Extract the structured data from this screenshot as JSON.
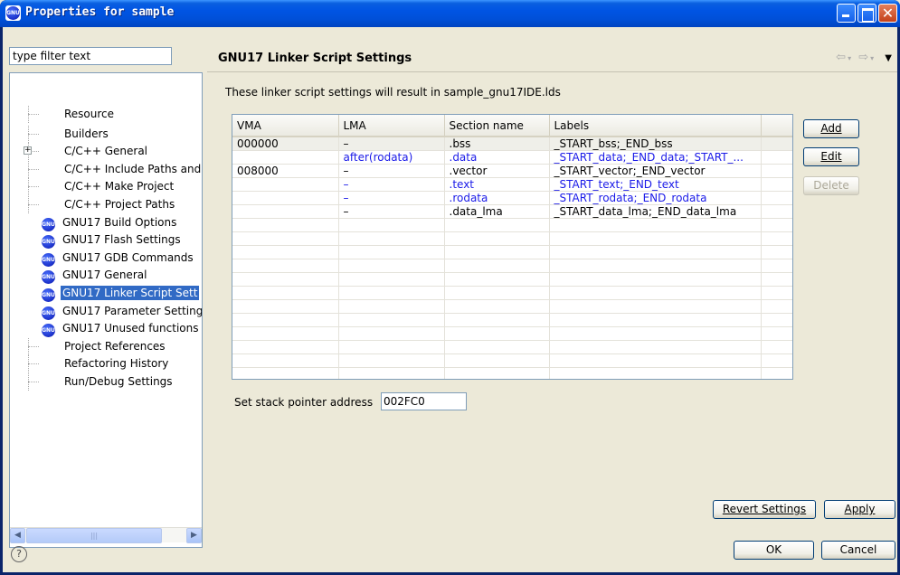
{
  "window": {
    "title": "Properties for sample"
  },
  "filter": {
    "value": "type filter text"
  },
  "tree": {
    "items": [
      {
        "label": "Resource",
        "kind": "plain"
      },
      {
        "label": "Builders",
        "kind": "plain"
      },
      {
        "label": "C/C++ General",
        "kind": "expandable"
      },
      {
        "label": "C/C++ Include Paths and",
        "kind": "plain"
      },
      {
        "label": "C/C++ Make Project",
        "kind": "plain"
      },
      {
        "label": "C/C++ Project Paths",
        "kind": "plain"
      },
      {
        "label": "GNU17 Build Options",
        "kind": "gnu"
      },
      {
        "label": "GNU17 Flash Settings",
        "kind": "gnu"
      },
      {
        "label": "GNU17 GDB Commands",
        "kind": "gnu"
      },
      {
        "label": "GNU17 General",
        "kind": "gnu"
      },
      {
        "label": "GNU17 Linker Script Sett",
        "kind": "gnu",
        "selected": true
      },
      {
        "label": "GNU17 Parameter Setting",
        "kind": "gnu"
      },
      {
        "label": "GNU17 Unused functions",
        "kind": "gnu"
      },
      {
        "label": "Project References",
        "kind": "plain"
      },
      {
        "label": "Refactoring History",
        "kind": "plain"
      },
      {
        "label": "Run/Debug Settings",
        "kind": "plain"
      }
    ],
    "expander_symbol": "+",
    "gnu_icon_text": "GNU"
  },
  "panel": {
    "title": "GNU17 Linker Script Settings",
    "description": "These linker script settings will result in sample_gnu17IDE.lds"
  },
  "table": {
    "columns": [
      "VMA",
      "LMA",
      "Section name",
      "Labels"
    ],
    "rows": [
      {
        "vma": "000000",
        "lma": "–",
        "section": ".bss",
        "labels": "_START_bss;_END_bss",
        "color": "black"
      },
      {
        "vma": "",
        "lma": "after(rodata)",
        "section": ".data",
        "labels": "_START_data;_END_data;_START_...",
        "color": "blue"
      },
      {
        "vma": "008000",
        "lma": "–",
        "section": ".vector",
        "labels": "_START_vector;_END_vector",
        "color": "black"
      },
      {
        "vma": "",
        "lma": "–",
        "section": ".text",
        "labels": "_START_text;_END_text",
        "color": "blue"
      },
      {
        "vma": "",
        "lma": "–",
        "section": ".rodata",
        "labels": "_START_rodata;_END_rodata",
        "color": "blue"
      },
      {
        "vma": "",
        "lma": "–",
        "section": ".data_lma",
        "labels": "_START_data_lma;_END_data_lma",
        "color": "black"
      }
    ],
    "empty_rows": 12
  },
  "buttons": {
    "add": "Add",
    "edit": "Edit",
    "delete": "Delete",
    "revert": "Revert Settings",
    "apply": "Apply",
    "ok": "OK",
    "cancel": "Cancel"
  },
  "stack": {
    "label": "Set stack pointer address",
    "value": "002FC0"
  },
  "help": {
    "symbol": "?"
  },
  "colors": {
    "title_blue": "#0054e3",
    "selection": "#316ac5",
    "link_blue": "#1a1ae8"
  }
}
